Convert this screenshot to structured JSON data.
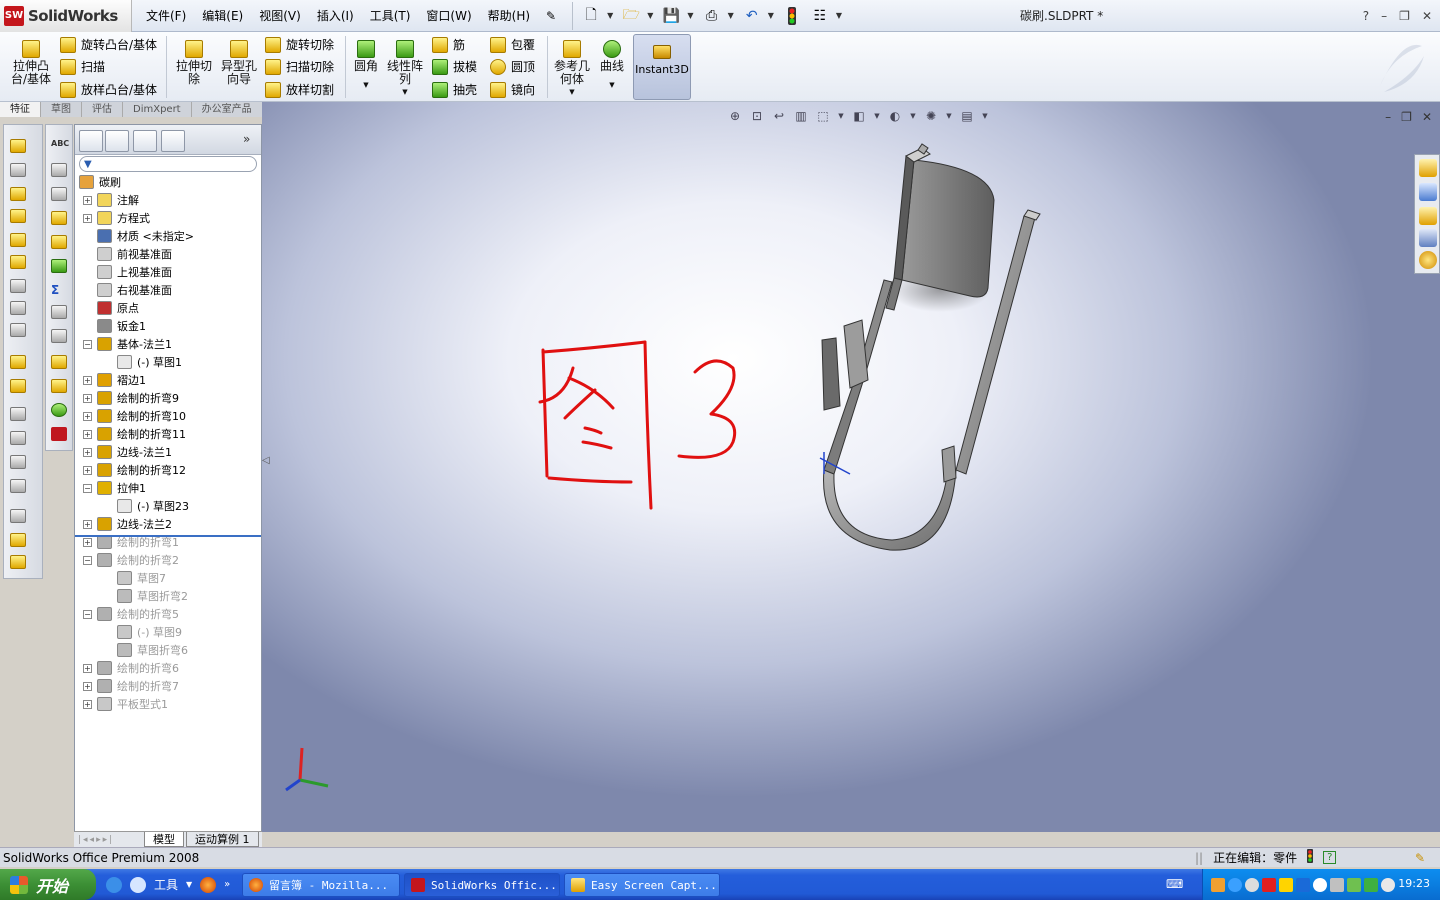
{
  "app": {
    "logo_text": "SolidWorks",
    "logo_badge": "SW",
    "doc_title": "碳刷.SLDPRT *"
  },
  "menu": [
    "文件(F)",
    "编辑(E)",
    "视图(V)",
    "插入(I)",
    "工具(T)",
    "窗口(W)",
    "帮助(H)"
  ],
  "window_buttons": [
    "?",
    "–",
    "❐",
    "✕"
  ],
  "command_manager": {
    "extrude_boss": "拉伸凸台/基体",
    "revolve_boss": "旋转凸台/基体",
    "sweep": "扫描",
    "loft_boss": "放样凸台/基体",
    "extrude_cut": "拉伸切除",
    "hole_wizard": "异型孔向导",
    "revolve_cut": "旋转切除",
    "sweep_cut": "扫描切除",
    "loft_cut": "放样切割",
    "fillet": "圆角",
    "linear_pattern": "线性阵列",
    "rib": "筋",
    "draft": "拔模",
    "shell": "抽壳",
    "wrap": "包覆",
    "dome": "圆顶",
    "mirror": "镜向",
    "ref_geometry": "参考几何体",
    "curves": "曲线",
    "instant3d": "Instant3D"
  },
  "cm_tabs": [
    "特征",
    "草图",
    "评估",
    "DimXpert",
    "办公室产品"
  ],
  "feature_tree": [
    {
      "label": "碳刷",
      "level": 0,
      "expander": "",
      "icon": "part-icon",
      "sup": false
    },
    {
      "label": "注解",
      "level": 1,
      "expander": "+",
      "icon": "annotation-icon",
      "sup": false
    },
    {
      "label": "方程式",
      "level": 1,
      "expander": "+",
      "icon": "equation-icon",
      "sup": false
    },
    {
      "label": "材质 <未指定>",
      "level": 1,
      "expander": "",
      "icon": "material-icon",
      "sup": false
    },
    {
      "label": "前视基准面",
      "level": 1,
      "expander": "",
      "icon": "plane-icon",
      "sup": false
    },
    {
      "label": "上视基准面",
      "level": 1,
      "expander": "",
      "icon": "plane-icon",
      "sup": false
    },
    {
      "label": "右视基准面",
      "level": 1,
      "expander": "",
      "icon": "plane-icon",
      "sup": false
    },
    {
      "label": "原点",
      "level": 1,
      "expander": "",
      "icon": "origin-icon",
      "sup": false
    },
    {
      "label": "钣金1",
      "level": 1,
      "expander": "",
      "icon": "sheetmetal-icon",
      "sup": false
    },
    {
      "label": "基体-法兰1",
      "level": 1,
      "expander": "−",
      "icon": "base-flange-icon",
      "sup": false
    },
    {
      "label": "(-) 草图1",
      "level": 2,
      "expander": "",
      "icon": "sketch-icon",
      "sup": false
    },
    {
      "label": "褶边1",
      "level": 1,
      "expander": "+",
      "icon": "hem-icon",
      "sup": false
    },
    {
      "label": "绘制的折弯9",
      "level": 1,
      "expander": "+",
      "icon": "sketched-bend-icon",
      "sup": false
    },
    {
      "label": "绘制的折弯10",
      "level": 1,
      "expander": "+",
      "icon": "sketched-bend-icon",
      "sup": false
    },
    {
      "label": "绘制的折弯11",
      "level": 1,
      "expander": "+",
      "icon": "sketched-bend-icon",
      "sup": false
    },
    {
      "label": "边线-法兰1",
      "level": 1,
      "expander": "+",
      "icon": "edge-flange-icon",
      "sup": false
    },
    {
      "label": "绘制的折弯12",
      "level": 1,
      "expander": "+",
      "icon": "sketched-bend-icon",
      "sup": false
    },
    {
      "label": "拉伸1",
      "level": 1,
      "expander": "−",
      "icon": "extrude-icon",
      "sup": false
    },
    {
      "label": "(-) 草图23",
      "level": 2,
      "expander": "",
      "icon": "sketch-icon",
      "sup": false
    },
    {
      "label": "边线-法兰2",
      "level": 1,
      "expander": "+",
      "icon": "edge-flange-icon",
      "sup": false
    },
    {
      "label": "绘制的折弯1",
      "level": 1,
      "expander": "+",
      "icon": "suppressed-bend-icon",
      "sup": true
    },
    {
      "label": "绘制的折弯2",
      "level": 1,
      "expander": "−",
      "icon": "suppressed-bend-icon",
      "sup": true
    },
    {
      "label": "草图7",
      "level": 2,
      "expander": "",
      "icon": "suppressed-sketch-icon",
      "sup": true
    },
    {
      "label": "草图折弯2",
      "level": 2,
      "expander": "",
      "icon": "bend-line-icon",
      "sup": true
    },
    {
      "label": "绘制的折弯5",
      "level": 1,
      "expander": "−",
      "icon": "suppressed-bend-icon",
      "sup": true
    },
    {
      "label": "(-) 草图9",
      "level": 2,
      "expander": "",
      "icon": "suppressed-sketch-icon",
      "sup": true
    },
    {
      "label": "草图折弯6",
      "level": 2,
      "expander": "",
      "icon": "bend-line-icon",
      "sup": true
    },
    {
      "label": "绘制的折弯6",
      "level": 1,
      "expander": "+",
      "icon": "suppressed-bend-icon",
      "sup": true
    },
    {
      "label": "绘制的折弯7",
      "level": 1,
      "expander": "+",
      "icon": "suppressed-bend-icon",
      "sup": true
    },
    {
      "label": "平板型式1",
      "level": 1,
      "expander": "+",
      "icon": "flat-pattern-icon",
      "sup": true
    }
  ],
  "fm_bottom_tabs": [
    "模型",
    "运动算例 1"
  ],
  "annotation_text": "图3",
  "status": {
    "left": "SolidWorks Office Premium 2008",
    "editing": "正在编辑：零件"
  },
  "taskbar": {
    "start": "开始",
    "quick_tools": "工具",
    "tasks": [
      "留言簿 - Mozilla...",
      "SolidWorks Offic...",
      "Easy Screen Capt..."
    ],
    "clock": "19:23"
  },
  "colors": {
    "annotation": "#e01010",
    "sw_red": "#c4161c",
    "taskbar": "#245edb"
  }
}
